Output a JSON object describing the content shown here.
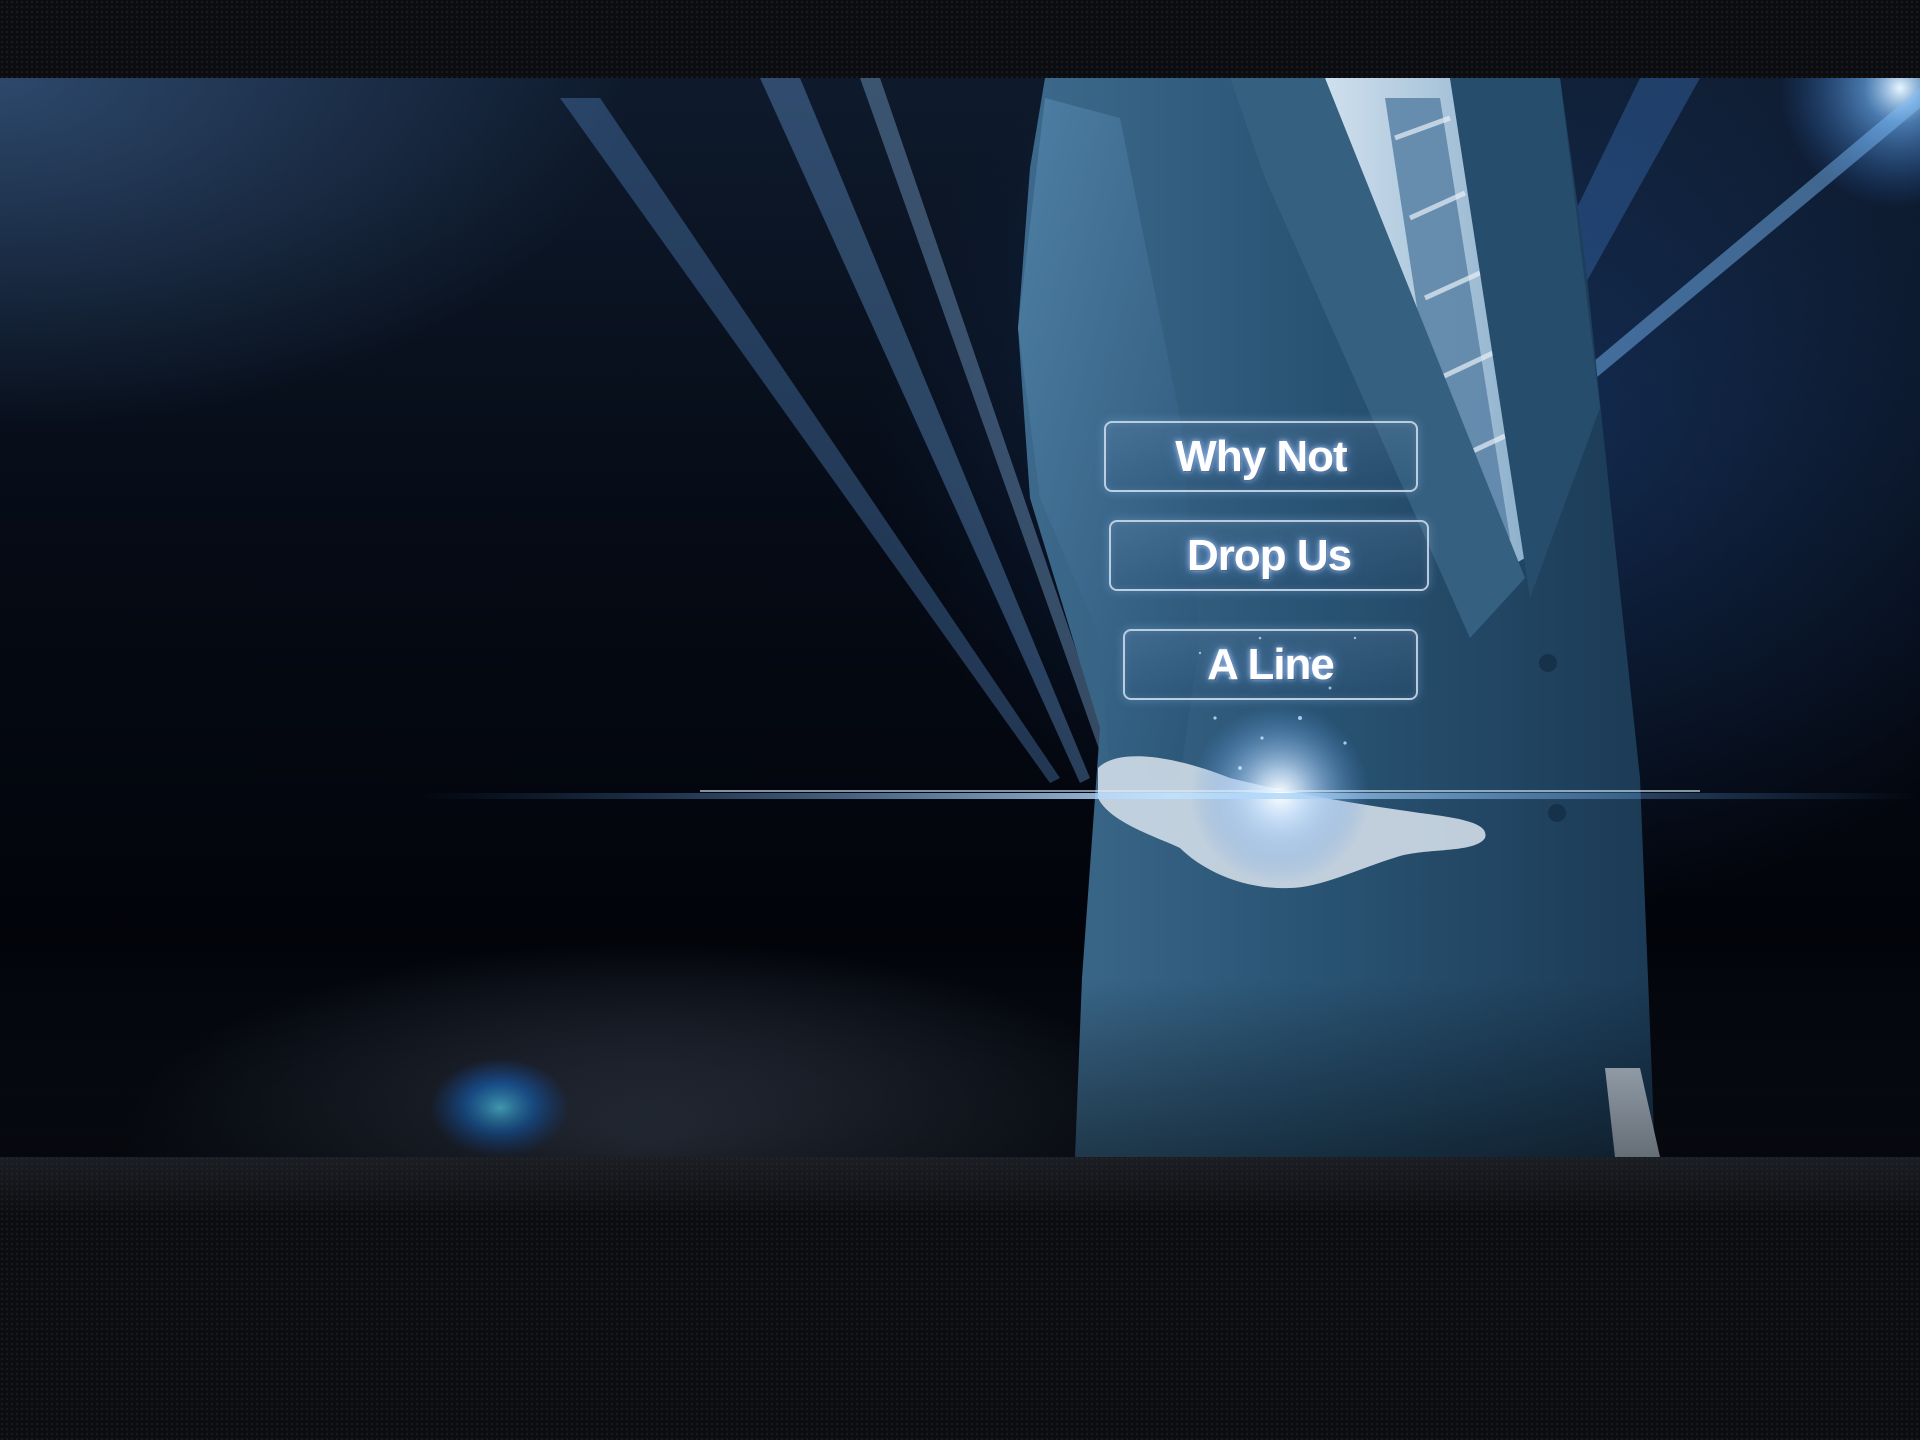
{
  "hero": {
    "buttons": [
      {
        "label": "Why Not"
      },
      {
        "label": "Drop Us"
      },
      {
        "label": "A Line"
      }
    ]
  },
  "colors": {
    "background": "#0b0c0e",
    "accent_blue": "#3c82d2",
    "suit_blue": "#2b5674",
    "button_text": "#ffffff"
  }
}
